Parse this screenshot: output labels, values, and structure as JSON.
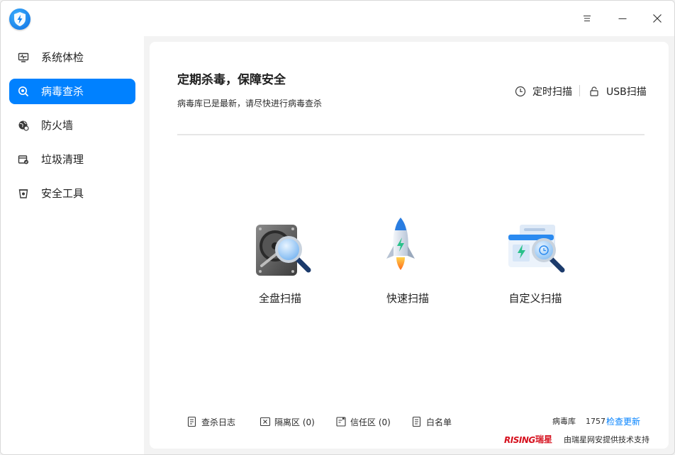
{
  "window": {
    "app_icon": "shield-lightning-icon",
    "controls": {
      "menu_icon": "hamburger-icon",
      "minimize_icon": "minimize-icon",
      "close_icon": "close-icon"
    }
  },
  "sidebar": {
    "items": [
      {
        "label": "系统体检",
        "icon": "monitor-pulse-icon",
        "active": false
      },
      {
        "label": "病毒查杀",
        "icon": "virus-scan-icon",
        "active": true
      },
      {
        "label": "防火墙",
        "icon": "firewall-globe-icon",
        "active": false
      },
      {
        "label": "垃圾清理",
        "icon": "cleanup-icon",
        "active": false
      },
      {
        "label": "安全工具",
        "icon": "toolbox-icon",
        "active": false
      }
    ]
  },
  "main": {
    "title": "定期杀毒，保障安全",
    "subtitle": "病毒库已是最新，请尽快进行病毒查杀",
    "top_actions": [
      {
        "label": "定时扫描",
        "icon": "clock-icon"
      },
      {
        "label": "USB扫描",
        "icon": "lock-icon"
      }
    ],
    "scan_options": [
      {
        "label": "全盘扫描",
        "icon": "hard-disk-magnifier-icon"
      },
      {
        "label": "快速扫描",
        "icon": "rocket-icon"
      },
      {
        "label": "自定义扫描",
        "icon": "window-magnifier-icon"
      }
    ],
    "bottom_links": [
      {
        "label": "查杀日志",
        "icon": "log-icon"
      },
      {
        "label": "隔离区 (0)",
        "icon": "quarantine-icon"
      },
      {
        "label": "信任区 (0)",
        "icon": "trust-icon"
      },
      {
        "label": "白名单",
        "icon": "whitelist-icon"
      }
    ],
    "virus_db": {
      "label": "病毒库",
      "version": "1757"
    },
    "update_label": "检查更新",
    "brand": {
      "logo_text": "RISING",
      "logo_cn": "瑞星",
      "provided_by": "由瑞星网安提供技术支持"
    }
  },
  "colors": {
    "accent": "#0081ff",
    "brand_red": "#d6121f",
    "background": "#f3f3f3",
    "panel": "#ffffff"
  }
}
